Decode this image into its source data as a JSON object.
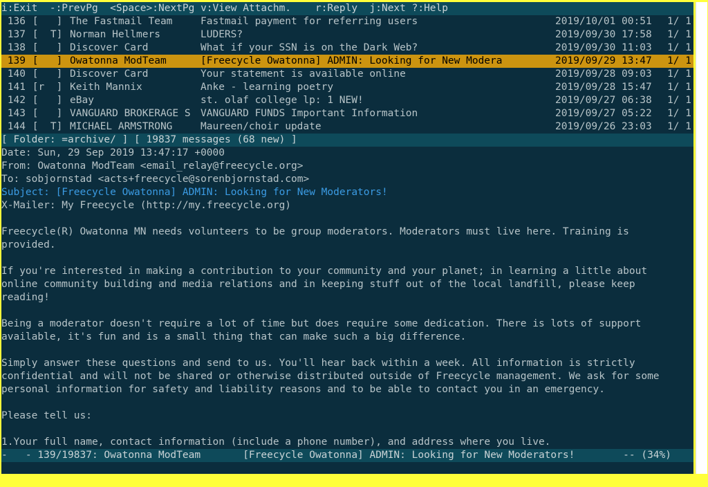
{
  "help_bar": "i:Exit  -:PrevPg  <Space>:NextPg v:View Attachm.    r:Reply  j:Next ?:Help",
  "index": [
    {
      "num": " 136",
      "flags": " [   ]",
      "from": "The Fastmail Team",
      "subject": "Fastmail payment for referring users",
      "date": "2019/10/01 00:51",
      "count": "1/ 1",
      "selected": false
    },
    {
      "num": " 137",
      "flags": " [  T]",
      "from": "Norman Hellmers",
      "subject": "LUDERS?",
      "date": "2019/09/30 17:58",
      "count": "1/ 1",
      "selected": false
    },
    {
      "num": " 138",
      "flags": " [   ]",
      "from": "Discover Card",
      "subject": "What if your SSN is on the Dark Web?",
      "date": "2019/09/30 11:03",
      "count": "1/ 1",
      "selected": false
    },
    {
      "num": " 139",
      "flags": " [   ]",
      "from": "Owatonna ModTeam",
      "subject": "[Freecycle Owatonna] ADMIN: Looking for New Modera",
      "date": "2019/09/29 13:47",
      "count": "1/ 1",
      "selected": true
    },
    {
      "num": " 140",
      "flags": " [   ]",
      "from": "Discover Card",
      "subject": "Your statement is available online",
      "date": "2019/09/28 09:03",
      "count": "1/ 1",
      "selected": false
    },
    {
      "num": " 141",
      "flags": " [r  ]",
      "from": "Keith Mannix",
      "subject": "Anke - learning poetry",
      "date": "2019/09/28 15:47",
      "count": "1/ 1",
      "selected": false
    },
    {
      "num": " 142",
      "flags": " [   ]",
      "from": "eBay",
      "subject": "st. olaf college lp: 1 NEW!",
      "date": "2019/09/27 06:38",
      "count": "1/ 1",
      "selected": false
    },
    {
      "num": " 143",
      "flags": " [   ]",
      "from": "VANGUARD BROKERAGE S",
      "subject": "VANGUARD FUNDS Important Information",
      "date": "2019/09/27 05:22",
      "count": "1/ 1",
      "selected": false
    },
    {
      "num": " 144",
      "flags": " [  T]",
      "from": "MICHAEL ARMSTRONG",
      "subject": "Maureen/choir update",
      "date": "2019/09/26 23:03",
      "count": "1/ 1",
      "selected": false
    }
  ],
  "folder_status": "[ Folder: =archive/ ] [ 19837 messages (68 new) ]",
  "headers": {
    "date": "Date: Sun, 29 Sep 2019 13:47:17 +0000",
    "from": "From: Owatonna ModTeam <email_relay@freecycle.org>",
    "to": "To: sobjornstad <acts+freecycle@sorenbjornstad.com>",
    "subject": "Subject: [Freecycle Owatonna] ADMIN: Looking for New Moderators!",
    "xmailer": "X-Mailer: My Freecycle (http://my.freecycle.org)"
  },
  "body_lines": [
    "",
    "Freecycle(R) Owatonna MN needs volunteers to be group moderators. Moderators must live here. Training is",
    "provided.",
    "",
    "If you're interested in making a contribution to your community and your planet; in learning a little about",
    "online community building and media relations and in keeping stuff out of the local landfill, please keep",
    "reading!",
    "",
    "Being a moderator doesn't require a lot of time but does require some dedication. There is lots of support",
    "available, it's fun and is a small thing that can make such a big difference.",
    "",
    "Simply answer these questions and send to us. You'll hear back within a week. All information is strictly",
    "confidential and will not be shared or otherwise distributed outside of Freecycle management. We ask for some",
    "personal information for safety and liability reasons and to be able to contact you in an emergency.",
    "",
    "Please tell us:",
    "",
    "1.Your full name, contact information (include a phone number), and address where you live."
  ],
  "pager_status": "-   - 139/19837: Owatonna ModTeam       [Freecycle Owatonna] ADMIN: Looking for New Moderators!        -- (34%)",
  "colors": {
    "selected_row": "#cc9410",
    "status_bar": "#0e4a5a",
    "subject_header": "#3b9be3",
    "background": "#0b2d3d"
  }
}
